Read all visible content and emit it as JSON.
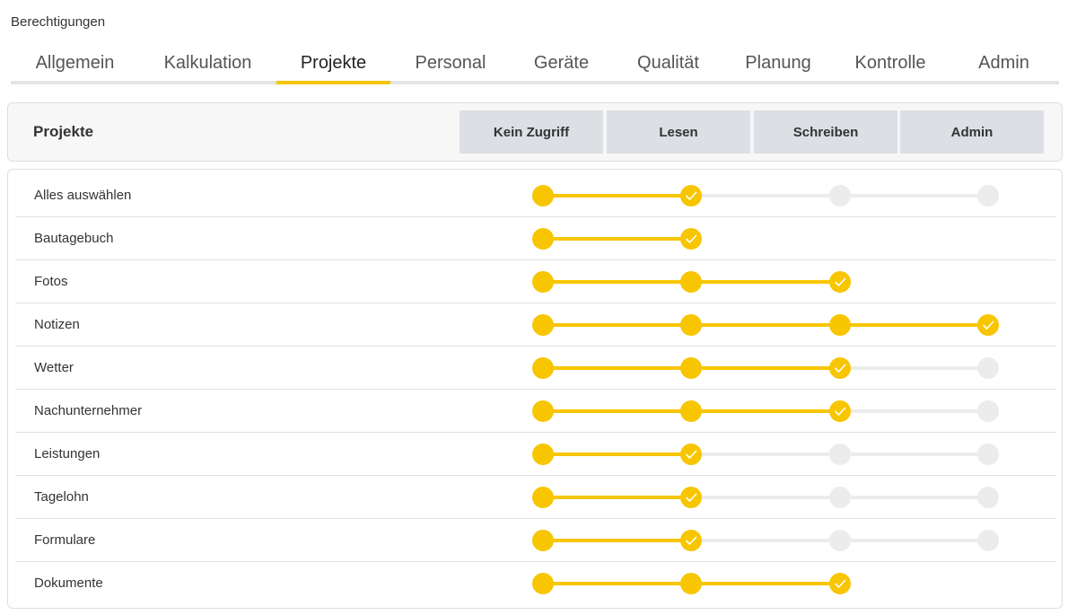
{
  "page": {
    "title": "Berechtigungen"
  },
  "tabs": [
    {
      "label": "Allgemein",
      "active": false
    },
    {
      "label": "Kalkulation",
      "active": false
    },
    {
      "label": "Projekte",
      "active": true
    },
    {
      "label": "Personal",
      "active": false
    },
    {
      "label": "Geräte",
      "active": false
    },
    {
      "label": "Qualität",
      "active": false
    },
    {
      "label": "Planung",
      "active": false
    },
    {
      "label": "Kontrolle",
      "active": false
    },
    {
      "label": "Admin",
      "active": false
    }
  ],
  "section": {
    "label": "Projekte"
  },
  "levels": [
    "Kein Zugriff",
    "Lesen",
    "Schreiben",
    "Admin"
  ],
  "colors": {
    "accent": "#f7c600",
    "inactive_track": "#ececec",
    "level_button": "#dcdfe4"
  },
  "rows": [
    {
      "label": "Alles auswählen",
      "value": 1,
      "max": 3
    },
    {
      "label": "Bautagebuch",
      "value": 1,
      "max": 1
    },
    {
      "label": "Fotos",
      "value": 2,
      "max": 2
    },
    {
      "label": "Notizen",
      "value": 3,
      "max": 3
    },
    {
      "label": "Wetter",
      "value": 2,
      "max": 3
    },
    {
      "label": "Nachunternehmer",
      "value": 2,
      "max": 3
    },
    {
      "label": "Leistungen",
      "value": 1,
      "max": 3
    },
    {
      "label": "Tagelohn",
      "value": 1,
      "max": 3
    },
    {
      "label": "Formulare",
      "value": 1,
      "max": 3
    },
    {
      "label": "Dokumente",
      "value": 2,
      "max": 2
    }
  ]
}
